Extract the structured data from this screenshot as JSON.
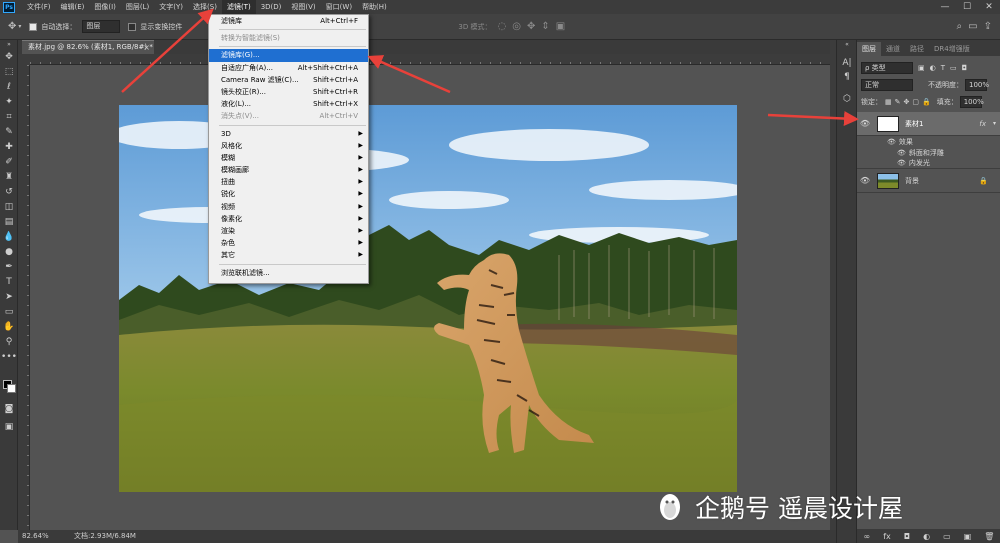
{
  "menubar": {
    "app_icon": "Ps",
    "items": [
      "文件(F)",
      "编辑(E)",
      "图像(I)",
      "图层(L)",
      "文字(Y)",
      "选择(S)",
      "滤镜(T)",
      "3D(D)",
      "视图(V)",
      "窗口(W)",
      "帮助(H)"
    ],
    "window_controls": [
      "—",
      "☐",
      "✕"
    ]
  },
  "options_bar": {
    "auto_select_label": "自动选择：",
    "auto_select_value": "图层",
    "show_transform_label": "显示变换控件",
    "mode_3d_label": "3D 模式："
  },
  "document_tab": {
    "label": "素材.jpg @ 82.6% (素材1, RGB/8#) *",
    "close": "×"
  },
  "status_bar": {
    "zoom": "82.64%",
    "doc_info": "文档:2.93M/6.84M"
  },
  "filter_menu": {
    "items": [
      {
        "label": "滤镜库",
        "shortcut": "Alt+Ctrl+F",
        "state": "normal"
      },
      {
        "type": "separator"
      },
      {
        "label": "转换为智能滤镜(S)",
        "shortcut": "",
        "state": "disabled"
      },
      {
        "type": "separator"
      },
      {
        "label": "滤镜库(G)...",
        "shortcut": "",
        "state": "highlighted"
      },
      {
        "label": "自适应广角(A)...",
        "shortcut": "Alt+Shift+Ctrl+A",
        "state": "normal"
      },
      {
        "label": "Camera Raw 滤镜(C)...",
        "shortcut": "Shift+Ctrl+A",
        "state": "normal"
      },
      {
        "label": "镜头校正(R)...",
        "shortcut": "Shift+Ctrl+R",
        "state": "normal"
      },
      {
        "label": "液化(L)...",
        "shortcut": "Shift+Ctrl+X",
        "state": "normal"
      },
      {
        "label": "消失点(V)...",
        "shortcut": "Alt+Ctrl+V",
        "state": "disabled"
      },
      {
        "type": "separator"
      },
      {
        "label": "3D",
        "submenu": true,
        "state": "normal"
      },
      {
        "label": "风格化",
        "submenu": true,
        "state": "normal"
      },
      {
        "label": "模糊",
        "submenu": true,
        "state": "normal"
      },
      {
        "label": "模糊画廊",
        "submenu": true,
        "state": "normal"
      },
      {
        "label": "扭曲",
        "submenu": true,
        "state": "normal"
      },
      {
        "label": "锐化",
        "submenu": true,
        "state": "normal"
      },
      {
        "label": "视频",
        "submenu": true,
        "state": "normal"
      },
      {
        "label": "像素化",
        "submenu": true,
        "state": "normal"
      },
      {
        "label": "渲染",
        "submenu": true,
        "state": "normal"
      },
      {
        "label": "杂色",
        "submenu": true,
        "state": "normal"
      },
      {
        "label": "其它",
        "submenu": true,
        "state": "normal"
      },
      {
        "type": "separator"
      },
      {
        "label": "浏览联机滤镜...",
        "shortcut": "",
        "state": "normal"
      }
    ]
  },
  "layers_panel": {
    "tabs": [
      "图层",
      "通道",
      "路径",
      "DR4增强版"
    ],
    "filter_kind": "ρ 类型",
    "blend_mode": "正常",
    "opacity_label": "不透明度：",
    "opacity_value": "100%",
    "lock_label": "锁定：",
    "fill_label": "填充：",
    "fill_value": "100%",
    "layers": [
      {
        "name": "素材1",
        "fx": "fx",
        "selected": true,
        "effects_label": "效果",
        "effects": [
          "斜面和浮雕",
          "内发光"
        ]
      },
      {
        "name": "背景",
        "locked": true,
        "selected": false
      }
    ],
    "footer_icons": [
      "∞",
      "fx",
      "◘",
      "◐",
      "▭",
      "▣",
      "🗑"
    ]
  },
  "watermark": {
    "text": "企鹅号 遥晨设计屋"
  },
  "colors": {
    "accent": "#1f6fd1",
    "arrow": "#e8413a"
  }
}
